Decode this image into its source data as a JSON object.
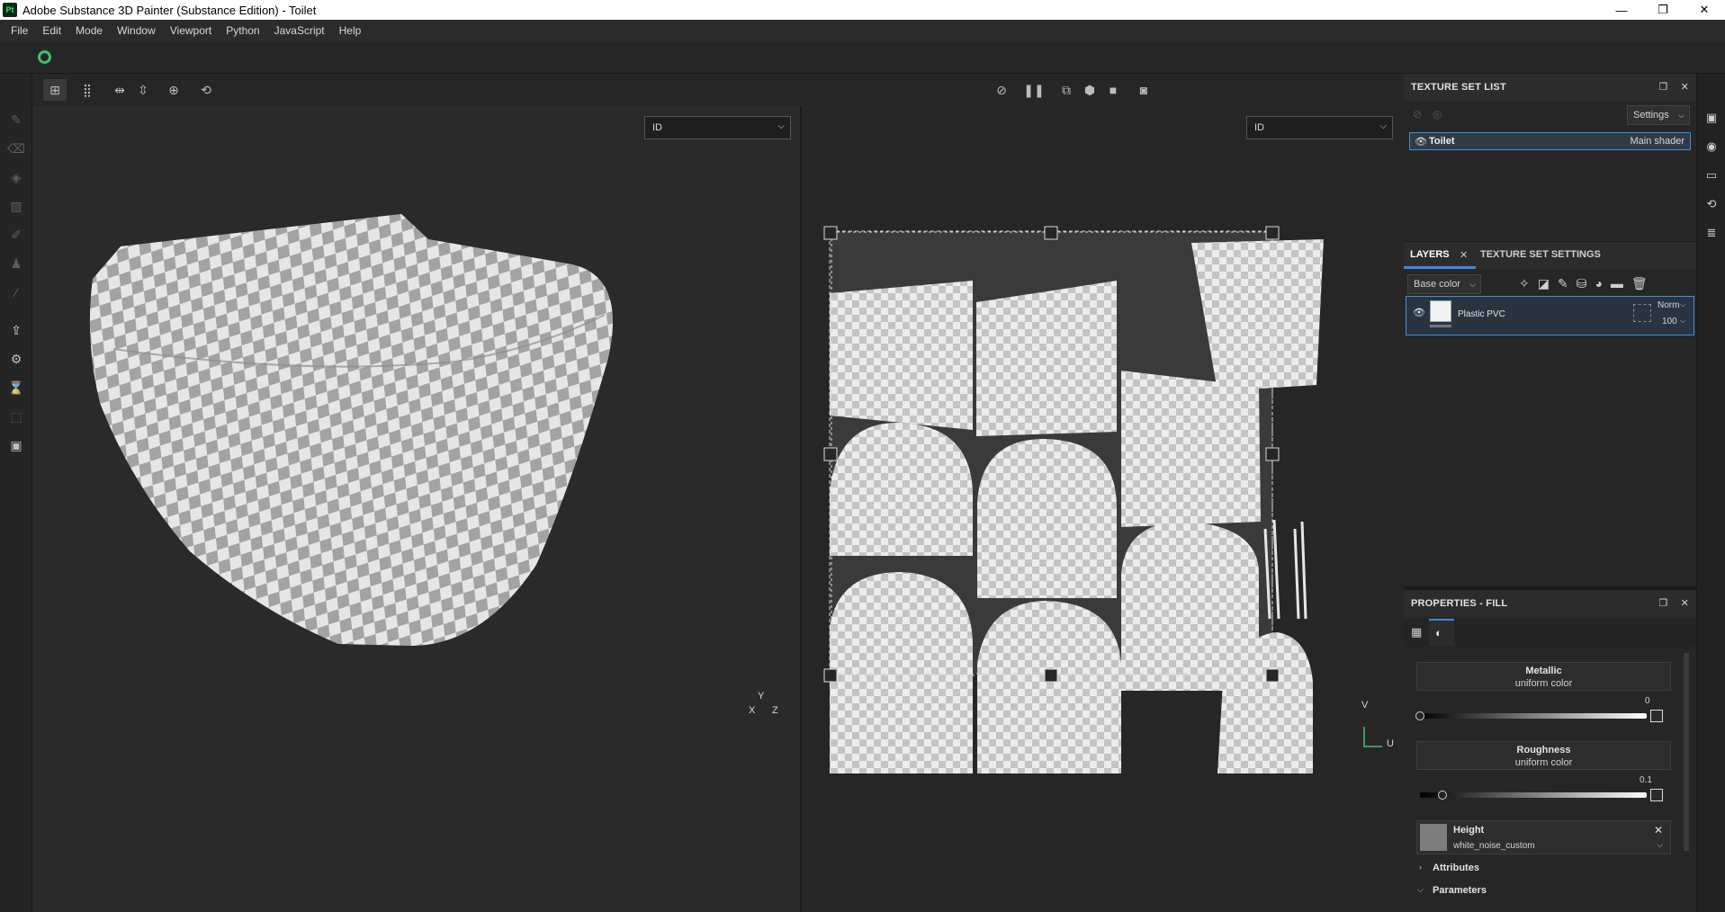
{
  "app": {
    "title": "Adobe Substance 3D Painter (Substance Edition) - Toilet",
    "icon_text": "Pt"
  },
  "window_controls": {
    "minimize": "—",
    "maximize": "❐",
    "close": "✕"
  },
  "menu": {
    "items": [
      "File",
      "Edit",
      "Mode",
      "Window",
      "Viewport",
      "Python",
      "JavaScript",
      "Help"
    ]
  },
  "viewport_3d": {
    "channel_select": "ID",
    "axis": {
      "y": "Y",
      "x": "X",
      "z": "Z"
    }
  },
  "viewport_2d": {
    "channel_select": "ID",
    "axis": {
      "v": "V",
      "u": "U"
    }
  },
  "texture_set_list": {
    "header": "TEXTURE SET LIST",
    "settings_button": "Settings",
    "rows": [
      {
        "name": "Toilet",
        "shader": "Main shader"
      }
    ]
  },
  "layers": {
    "tab_layers": "LAYERS",
    "tab_texture_set_settings": "TEXTURE SET SETTINGS",
    "channel_dropdown": "Base color",
    "rows": [
      {
        "name": "Plastic PVC",
        "blend": "Norm",
        "opacity": "100"
      }
    ]
  },
  "properties": {
    "header": "PROPERTIES - FILL",
    "metallic": {
      "title": "Metallic",
      "sub": "uniform color",
      "value": "0",
      "level": 0
    },
    "roughness": {
      "title": "Roughness",
      "sub": "uniform color",
      "value": "0.1",
      "level": 0.1
    },
    "height": {
      "title": "Height",
      "resource": "white_noise_custom"
    },
    "attributes_label": "Attributes",
    "parameters_label": "Parameters"
  },
  "colors": {
    "accent": "#3d8ae0",
    "sync_green": "#3ec26b",
    "checker_light": "#e8e8e8",
    "checker_dark": "#9a9a9a"
  }
}
